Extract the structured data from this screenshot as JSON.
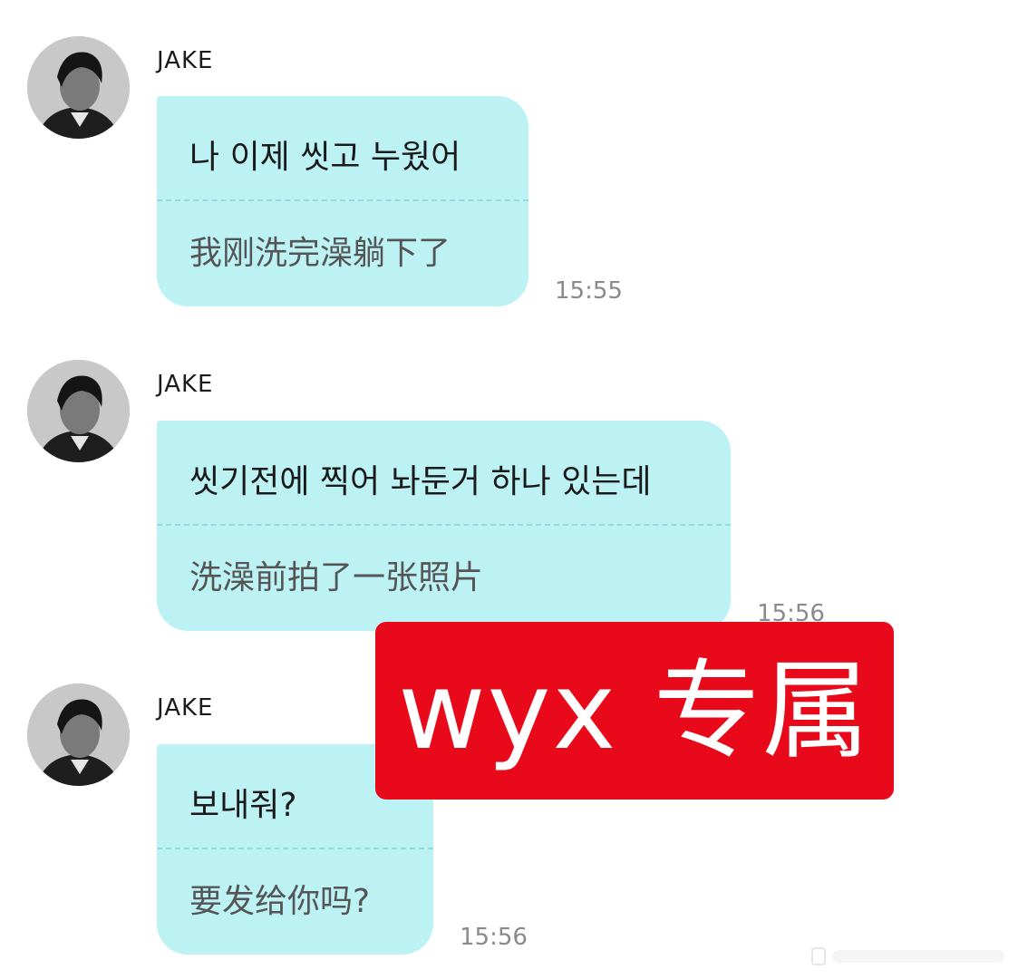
{
  "messages": [
    {
      "sender": "JAKE",
      "original": "나 이제 씻고 누웠어",
      "translation": "我刚洗完澡躺下了",
      "time": "15:55"
    },
    {
      "sender": "JAKE",
      "original": "씻기전에 찍어 놔둔거 하나 있는데",
      "translation": "洗澡前拍了一张照片",
      "time": "15:56"
    },
    {
      "sender": "JAKE",
      "original": "보내줘?",
      "translation": "要发给你吗?",
      "time": "15:56"
    }
  ],
  "watermark": {
    "text": "wyx 专属"
  },
  "colors": {
    "bubble": "#bdf2f5",
    "watermark_bg": "#e8091b",
    "time": "#8a8a8a"
  }
}
